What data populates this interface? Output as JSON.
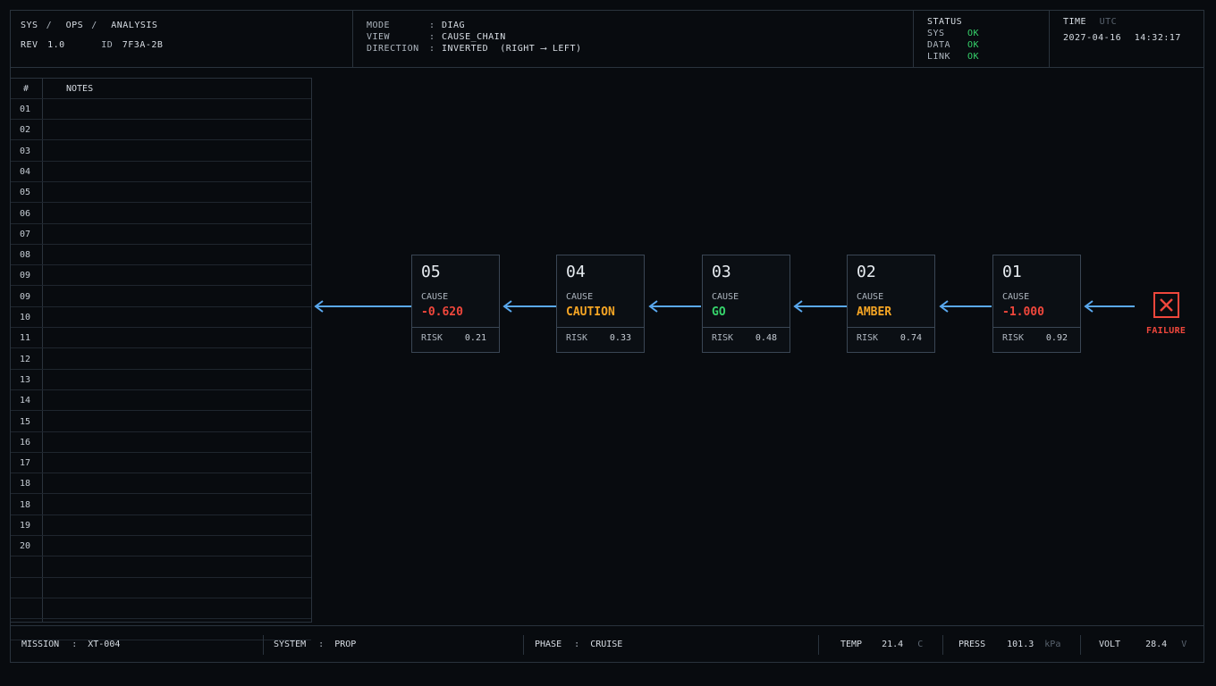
{
  "header": {
    "breadcrumb": [
      "SYS",
      "OPS",
      "ANALYSIS"
    ],
    "rev_label": "REV",
    "rev_value": "1.0",
    "id_label": "ID",
    "id_value": "7F3A-2B",
    "mode": {
      "rows": [
        {
          "key": "MODE",
          "value": "DIAG"
        },
        {
          "key": "VIEW",
          "value": "CAUSE_CHAIN"
        },
        {
          "key": "DIRECTION",
          "value": "INVERTED  (RIGHT ⟶ LEFT)"
        }
      ]
    },
    "status": {
      "title": "STATUS",
      "rows": [
        {
          "key": "SYS",
          "value": "OK"
        },
        {
          "key": "DATA",
          "value": "OK"
        },
        {
          "key": "LINK",
          "value": "OK"
        }
      ]
    },
    "time": {
      "label": "TIME",
      "zone": "UTC",
      "date": "2027-04-16",
      "clock": "14:32:17"
    }
  },
  "notes": {
    "headers": {
      "num": "#",
      "notes": "NOTES"
    },
    "rows": [
      "01",
      "02",
      "03",
      "04",
      "05",
      "06",
      "07",
      "08",
      "09",
      "09",
      "10",
      "11",
      "12",
      "13",
      "14",
      "15",
      "16",
      "17",
      "18",
      "18",
      "19",
      "20",
      "",
      "",
      "",
      ""
    ]
  },
  "chain": {
    "nodes": [
      {
        "id": "05",
        "cause_label": "CAUSE",
        "cause_value": "-0.620",
        "risk_label": "RISK",
        "risk_value": "0.21",
        "color": "#f0473c"
      },
      {
        "id": "04",
        "cause_label": "CAUSE",
        "cause_value": "CAUTION",
        "risk_label": "RISK",
        "risk_value": "0.33",
        "color": "#f5a524"
      },
      {
        "id": "03",
        "cause_label": "CAUSE",
        "cause_value": "GO",
        "risk_label": "RISK",
        "risk_value": "0.48",
        "color": "#36d36b"
      },
      {
        "id": "02",
        "cause_label": "CAUSE",
        "cause_value": "AMBER",
        "risk_label": "RISK",
        "risk_value": "0.74",
        "color": "#f5a524"
      },
      {
        "id": "01",
        "cause_label": "CAUSE",
        "cause_value": "-1.000",
        "risk_label": "RISK",
        "risk_value": "0.92",
        "color": "#f0473c"
      }
    ],
    "failure_label": "FAILURE",
    "failure_icon": "close-x-icon",
    "arrow_color": "#5aa9f0",
    "failure_color": "#f0473c"
  },
  "footer": {
    "mission_label": "MISSION",
    "mission_value": "XT-004",
    "system_label": "SYSTEM",
    "system_value": "PROP",
    "phase_label": "PHASE",
    "phase_value": "CRUISE",
    "temp_label": "TEMP",
    "temp_value": "21.4",
    "temp_unit": "C",
    "press_label": "PRESS",
    "press_value": "101.3",
    "press_unit": "kPa",
    "volt_label": "VOLT",
    "volt_value": "28.4",
    "volt_unit": "V"
  }
}
